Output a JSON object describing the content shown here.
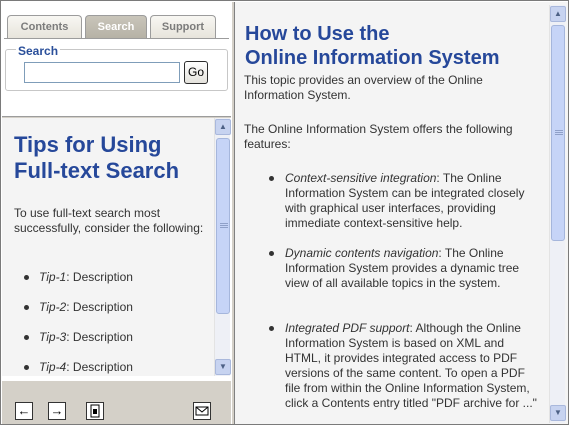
{
  "tabs": [
    {
      "label": "Contents",
      "active": false
    },
    {
      "label": "Search",
      "active": true
    },
    {
      "label": "Support",
      "active": false
    }
  ],
  "search": {
    "legend": "Search",
    "value": "",
    "go_label": "Go"
  },
  "left": {
    "title": "Tips for Using Full-text Search",
    "intro": "To use full-text search most successfully, consider the following:",
    "tips": [
      {
        "name": "Tip-1",
        "desc": ": Description"
      },
      {
        "name": "Tip-2",
        "desc": ": Description"
      },
      {
        "name": "Tip-3",
        "desc": ": Description"
      },
      {
        "name": "Tip-4",
        "desc": ": Description"
      }
    ]
  },
  "toolbar": {
    "back_icon": "back-arrow-icon",
    "forward_icon": "forward-arrow-icon",
    "pdf_icon": "pdf-document-icon",
    "email_icon": "email-envelope-icon"
  },
  "right": {
    "title_line1": "How to Use the",
    "title_line2": "Online Information System",
    "overview": "This topic provides an overview of the Online Information System.",
    "features_intro": "The Online Information System offers the following features:",
    "features": [
      {
        "term": "Context-sensitive integration",
        "text": ": The Online Information System can be integrated closely with graphical user interfaces, providing immediate context-sensitive help."
      },
      {
        "term": "Dynamic contents navigation",
        "text": ": The Online Information System provides a dynamic tree view of all available topics in the system."
      },
      {
        "term": "Integrated PDF support",
        "text": ": Although the Online Information System is based on XML and HTML, it provides integrated access to PDF versions of the same content. To open a PDF file from within the Online Information System, click a Contents entry titled \"PDF archive for ...\""
      }
    ]
  },
  "colors": {
    "heading": "#26489a",
    "legend": "#2a4f9a",
    "pane_bg": "#f4f4f4",
    "chrome": "#d4d0c8",
    "scroll_thumb": "#c6d4f7"
  }
}
